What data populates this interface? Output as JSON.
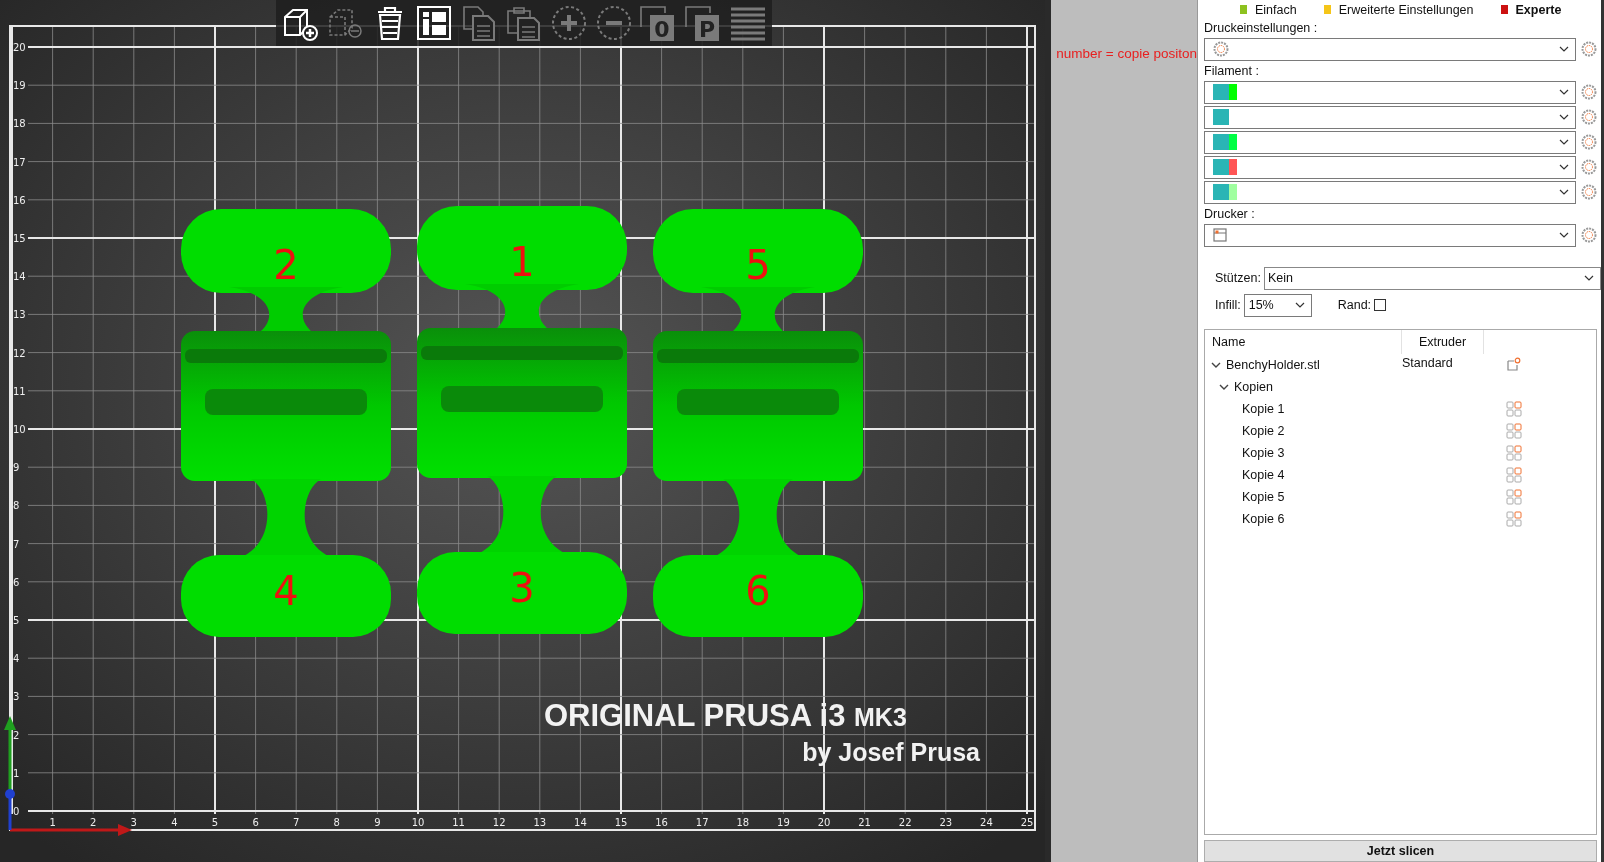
{
  "toolbar": [
    {
      "kind": "add-object",
      "disabled": false
    },
    {
      "kind": "remove-object",
      "disabled": true
    },
    {
      "kind": "delete",
      "disabled": false
    },
    {
      "kind": "info",
      "disabled": false
    },
    {
      "kind": "copy",
      "disabled": true
    },
    {
      "kind": "paste",
      "disabled": true
    },
    {
      "kind": "zoom-in",
      "disabled": true
    },
    {
      "kind": "zoom-out",
      "disabled": true
    },
    {
      "kind": "letter",
      "label": "0",
      "disabled": true
    },
    {
      "kind": "letter",
      "label": "P",
      "disabled": true
    },
    {
      "kind": "layers",
      "disabled": true
    }
  ],
  "viewport": {
    "x_labels": [
      "1",
      "2",
      "3",
      "4",
      "5",
      "6",
      "7",
      "8",
      "9",
      "10",
      "11",
      "12",
      "13",
      "14",
      "15",
      "16",
      "17",
      "18",
      "19",
      "20",
      "21",
      "22",
      "23",
      "24",
      "25"
    ],
    "y_labels": [
      "20",
      "19",
      "18",
      "17",
      "16",
      "15",
      "14",
      "13",
      "12",
      "11",
      "10",
      "9",
      "8",
      "7",
      "6",
      "5",
      "4",
      "3",
      "2",
      "1",
      "0"
    ],
    "objects": [
      {
        "top_label": "2",
        "bottom_label": "4"
      },
      {
        "top_label": "1",
        "bottom_label": "3"
      },
      {
        "top_label": "5",
        "bottom_label": "6"
      }
    ],
    "brand": "ORIGINAL PRUSA i3",
    "brand_model": "MK3",
    "brand_by": "by Josef Prusa"
  },
  "note": "number = copie positon",
  "modes": [
    {
      "label": "Einfach",
      "color": "#8dc21f",
      "selected": false
    },
    {
      "label": "Erweiterte Einstellungen",
      "color": "#f5c518",
      "selected": false
    },
    {
      "label": "Experte",
      "color": "#cc1111",
      "selected": true
    }
  ],
  "print_settings": {
    "label": "Druckeinstellungen :"
  },
  "filament": {
    "label": "Filament :",
    "items": [
      {
        "swatches": [
          {
            "color": "#2ab5b5"
          },
          {
            "color": "#00ff00"
          }
        ]
      },
      {
        "swatches": [
          {
            "color": "#2ab5b5"
          }
        ]
      },
      {
        "swatches": [
          {
            "color": "#2ab5b5"
          },
          {
            "color": "#00ff44"
          }
        ]
      },
      {
        "swatches": [
          {
            "color": "#2ab5b5"
          },
          {
            "color": "#ff5555"
          }
        ]
      },
      {
        "swatches": [
          {
            "color": "#2ab5b5"
          },
          {
            "color": "#a0ffa0"
          }
        ]
      }
    ]
  },
  "printer": {
    "label": "Drucker :"
  },
  "supports": {
    "label": "Stützen:",
    "value": "Kein"
  },
  "infill": {
    "label": "Infill:",
    "value": "15%"
  },
  "brim": {
    "label": "Rand:",
    "checked": false
  },
  "tree": {
    "columns": [
      "Name",
      "Extruder"
    ],
    "items": [
      {
        "name": "BenchyHolder.stl",
        "kind": "object",
        "extruder": "Standard",
        "expanded": true,
        "children": [
          {
            "name": "Kopien",
            "expanded": true,
            "children": [
              {
                "name": "Kopie 1",
                "kind": "copy"
              },
              {
                "name": "Kopie 2",
                "kind": "copy"
              },
              {
                "name": "Kopie 3",
                "kind": "copy"
              },
              {
                "name": "Kopie 4",
                "kind": "copy"
              },
              {
                "name": "Kopie 5",
                "kind": "copy"
              },
              {
                "name": "Kopie 6",
                "kind": "copy"
              }
            ]
          }
        ]
      }
    ]
  },
  "slice_button": "Jetzt slicen"
}
